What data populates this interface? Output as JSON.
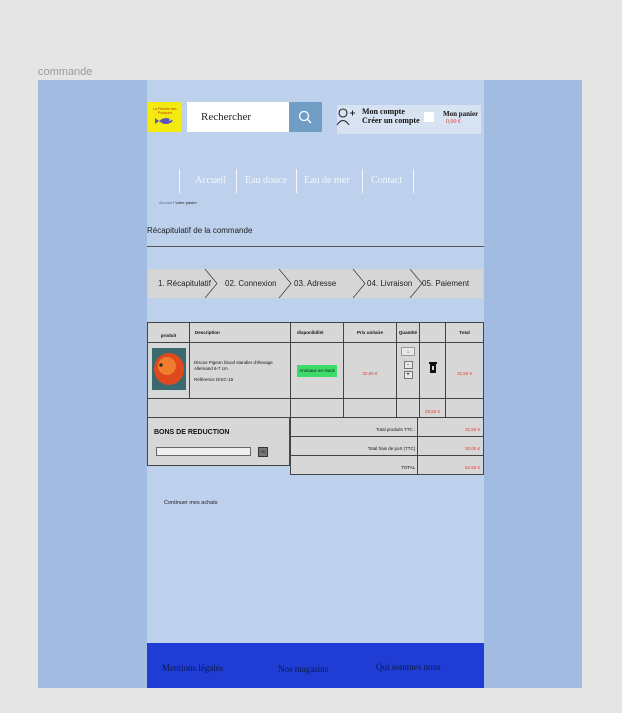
{
  "frame": {
    "label": "commande"
  },
  "header": {
    "logo_text": "La Planète des Poissons",
    "search_placeholder": "Rechercher",
    "account_line1": "Mon compte",
    "account_line2": "Créer un compte",
    "cart_label": "Mon panier",
    "cart_amount": "0,00 €"
  },
  "nav": {
    "items": [
      "Accueil",
      "Eau douce",
      "Eau de mer",
      "Contact"
    ]
  },
  "breadcrumb": {
    "home": "Accueil",
    "current": " / Votre panier"
  },
  "section_title": "Récapitulatif de la commande",
  "steps": [
    "1. Récapitulatif",
    "02. Connexion",
    "03. Adresse",
    "04. Livraison",
    "05. Paiement"
  ],
  "table": {
    "headers": {
      "product": "produit",
      "description": "Description",
      "availability": "disponibilité",
      "unit_price": "Prix unitaire",
      "quantity": "Quantité",
      "total": "Total"
    },
    "row": {
      "name": "Discus Pigeon blood standier d'élevage Allemand 6-7 cm",
      "reference": "Référence DISC-15",
      "availability": "Animaux en stock",
      "unit_price": "32,50 €",
      "quantity": "1",
      "qty_minus": "-",
      "qty_plus": "+",
      "total": "32,50 €"
    },
    "subtotal": "28,50 €"
  },
  "discount": {
    "title": "BONS DE REDUCTION",
    "ok_label": "OK"
  },
  "totals": [
    {
      "label": "Total produits TTC :",
      "value": "32,50 €"
    },
    {
      "label": "Total frais de port (TTC)",
      "value": "30,00 €"
    },
    {
      "label": "TOTAL",
      "value": "62,50 €"
    }
  ],
  "continue_label": "Continuer mes achats",
  "footer": {
    "items": [
      "Mentions légales",
      "Nos magasins",
      "Qui sommes nous"
    ]
  },
  "colors": {
    "accent_blue": "#1f3cd4",
    "stock_green": "#3ddc6a",
    "price_red": "#e33b3b",
    "logo_yellow": "#f4ea10"
  }
}
